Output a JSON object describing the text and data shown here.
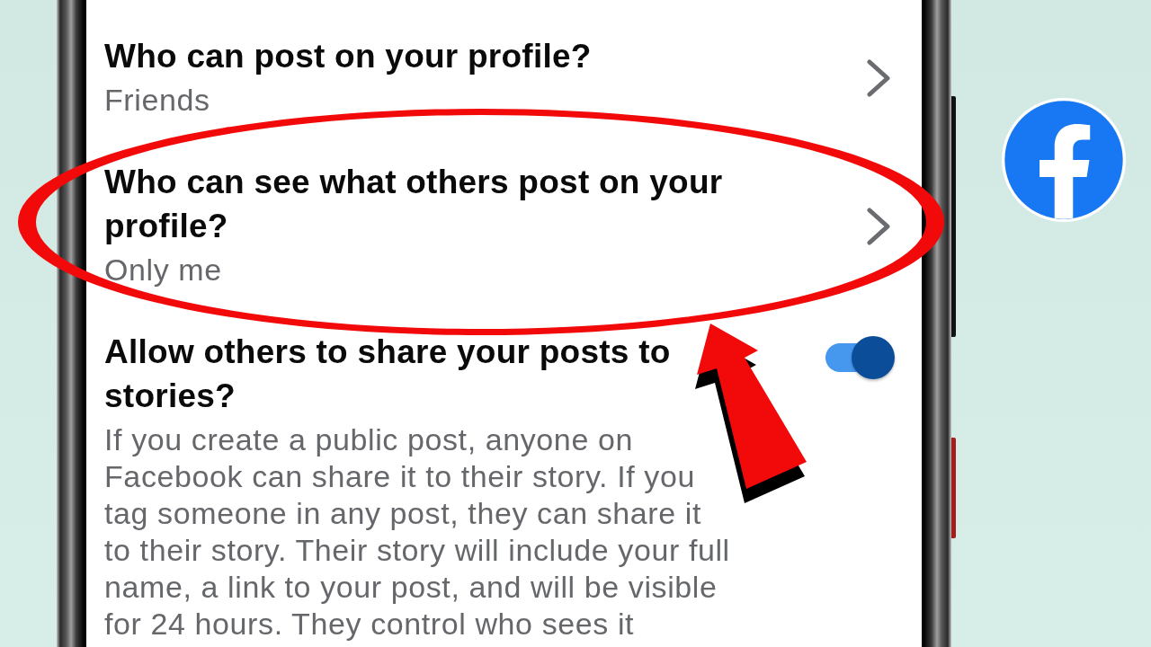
{
  "settings": [
    {
      "kind": "link",
      "title": "Who can post on your profile?",
      "value": "Friends"
    },
    {
      "kind": "link",
      "title": "Who can see what others post on your profile?",
      "value": "Only me"
    },
    {
      "kind": "toggle",
      "title": "Allow others to share your posts to stories?",
      "on": true,
      "description": "If you create a public post, anyone on Facebook can share it to their story. If you tag someone in any post, they can share it to their story. Their story will include your full name, a link to your post, and will be visible for 24 hours. They control who sees it"
    }
  ]
}
